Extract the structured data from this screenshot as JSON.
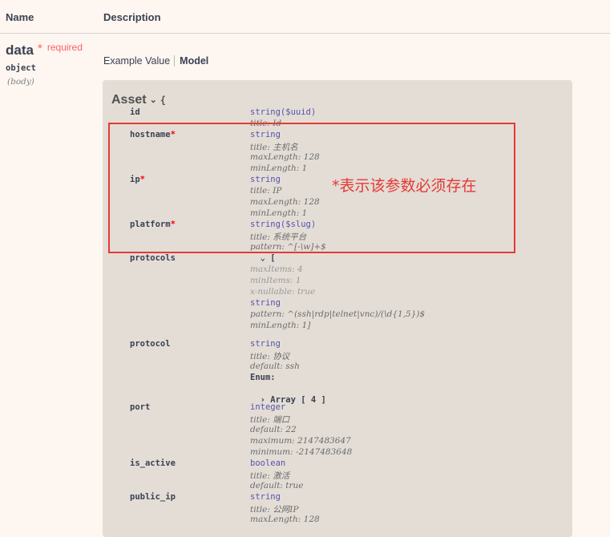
{
  "header": {
    "name": "Name",
    "description": "Description"
  },
  "param": {
    "name": "data",
    "required": "required",
    "required_star": "*",
    "type": "object",
    "in": "(body)"
  },
  "tabs": {
    "example_value": "Example Value",
    "model": "Model"
  },
  "model": {
    "title": "Asset",
    "open_brace": "{",
    "props": [
      {
        "name": "id",
        "required": false,
        "lines": [
          {
            "cls": "t",
            "text": "string($uuid)"
          },
          {
            "cls": "k",
            "text": "title: Id"
          }
        ]
      },
      {
        "name": "hostname",
        "required": true,
        "lines": [
          {
            "cls": "t",
            "text": "string"
          },
          {
            "cls": "k",
            "text": "title: 主机名"
          },
          {
            "cls": "k",
            "text": "maxLength: 128"
          },
          {
            "cls": "k",
            "text": "minLength: 1"
          }
        ]
      },
      {
        "name": "ip",
        "required": true,
        "lines": [
          {
            "cls": "t",
            "text": "string"
          },
          {
            "cls": "k",
            "text": "title: IP"
          },
          {
            "cls": "k",
            "text": "maxLength: 128"
          },
          {
            "cls": "k",
            "text": "minLength: 1"
          }
        ]
      },
      {
        "name": "platform",
        "required": true,
        "lines": [
          {
            "cls": "t",
            "text": "string($slug)"
          },
          {
            "cls": "k",
            "text": "title: 系统平台"
          },
          {
            "cls": "k",
            "text": "pattern: ^[-\\w]+$"
          }
        ]
      },
      {
        "name": "protocols",
        "required": false,
        "lines": [
          {
            "cls": "arr",
            "text": "  ⌄ ["
          },
          {
            "cls": "g",
            "text": "maxItems: 4"
          },
          {
            "cls": "g",
            "text": "minItems: 1"
          },
          {
            "cls": "g",
            "text": "x-nullable: true"
          },
          {
            "cls": "t",
            "text": "string"
          },
          {
            "cls": "k",
            "text": "pattern: ^(ssh|rdp|telnet|vnc)/(\\d{1,5})$"
          },
          {
            "cls": "k",
            "text": "minLength: 1]"
          }
        ]
      },
      {
        "name": "protocol",
        "required": false,
        "lines": [
          {
            "cls": "t",
            "text": "string"
          },
          {
            "cls": "k",
            "text": "title: 协议"
          },
          {
            "cls": "k",
            "text": "default: ssh"
          },
          {
            "cls": "enum",
            "text": "Enum:"
          },
          {
            "cls": "arr",
            "text": ""
          },
          {
            "cls": "arr",
            "text": "  › Array [ 4 ]"
          }
        ]
      },
      {
        "name": "port",
        "required": false,
        "lines": [
          {
            "cls": "t",
            "text": "integer"
          },
          {
            "cls": "k",
            "text": "title: 端口"
          },
          {
            "cls": "k",
            "text": "default: 22"
          },
          {
            "cls": "k",
            "text": "maximum: 2147483647"
          },
          {
            "cls": "k",
            "text": "minimum: -2147483648"
          }
        ]
      },
      {
        "name": "is_active",
        "required": false,
        "lines": [
          {
            "cls": "t",
            "text": "boolean"
          },
          {
            "cls": "k",
            "text": "title: 激活"
          },
          {
            "cls": "k",
            "text": "default: true"
          }
        ]
      },
      {
        "name": "public_ip",
        "required": false,
        "lines": [
          {
            "cls": "t",
            "text": "string"
          },
          {
            "cls": "k",
            "text": "title: 公网IP"
          },
          {
            "cls": "k",
            "text": "maxLength: 128"
          }
        ]
      }
    ]
  },
  "annotation": "*表示该参数必须存在",
  "colors": {
    "background": "#fdf6f1",
    "model_bg": "#e3ddd6",
    "highlight": "#e53935",
    "required": "#ff6060"
  }
}
